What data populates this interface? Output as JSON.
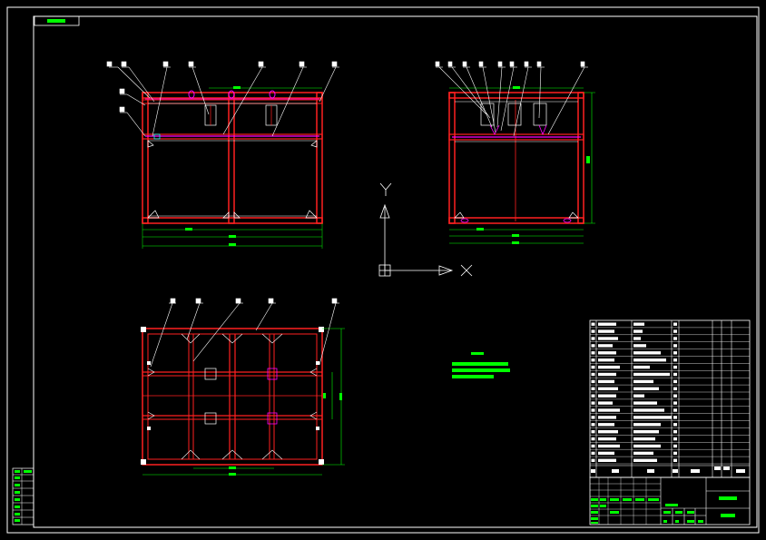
{
  "drawing": {
    "corner_tag": "",
    "axis_x_label": "X",
    "axis_y_label": "Y",
    "tech_title": "",
    "title_block": {
      "name": "",
      "drawing_no": ""
    }
  },
  "colors": {
    "background": "#000000",
    "line": "#ffffff",
    "frame": "#ff2020",
    "dimension": "#00ff00",
    "accent": "#ff00ff"
  }
}
